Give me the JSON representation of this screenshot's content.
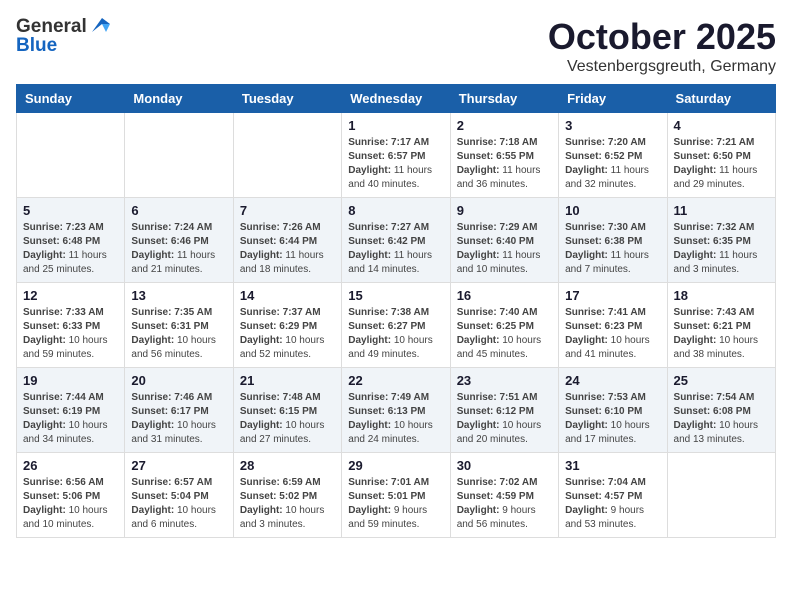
{
  "header": {
    "logo_general": "General",
    "logo_blue": "Blue",
    "month": "October 2025",
    "location": "Vestenbergsgreuth, Germany"
  },
  "weekdays": [
    "Sunday",
    "Monday",
    "Tuesday",
    "Wednesday",
    "Thursday",
    "Friday",
    "Saturday"
  ],
  "weeks": [
    [
      {
        "day": "",
        "info": ""
      },
      {
        "day": "",
        "info": ""
      },
      {
        "day": "",
        "info": ""
      },
      {
        "day": "1",
        "info": "Sunrise: 7:17 AM\nSunset: 6:57 PM\nDaylight: 11 hours\nand 40 minutes."
      },
      {
        "day": "2",
        "info": "Sunrise: 7:18 AM\nSunset: 6:55 PM\nDaylight: 11 hours\nand 36 minutes."
      },
      {
        "day": "3",
        "info": "Sunrise: 7:20 AM\nSunset: 6:52 PM\nDaylight: 11 hours\nand 32 minutes."
      },
      {
        "day": "4",
        "info": "Sunrise: 7:21 AM\nSunset: 6:50 PM\nDaylight: 11 hours\nand 29 minutes."
      }
    ],
    [
      {
        "day": "5",
        "info": "Sunrise: 7:23 AM\nSunset: 6:48 PM\nDaylight: 11 hours\nand 25 minutes."
      },
      {
        "day": "6",
        "info": "Sunrise: 7:24 AM\nSunset: 6:46 PM\nDaylight: 11 hours\nand 21 minutes."
      },
      {
        "day": "7",
        "info": "Sunrise: 7:26 AM\nSunset: 6:44 PM\nDaylight: 11 hours\nand 18 minutes."
      },
      {
        "day": "8",
        "info": "Sunrise: 7:27 AM\nSunset: 6:42 PM\nDaylight: 11 hours\nand 14 minutes."
      },
      {
        "day": "9",
        "info": "Sunrise: 7:29 AM\nSunset: 6:40 PM\nDaylight: 11 hours\nand 10 minutes."
      },
      {
        "day": "10",
        "info": "Sunrise: 7:30 AM\nSunset: 6:38 PM\nDaylight: 11 hours\nand 7 minutes."
      },
      {
        "day": "11",
        "info": "Sunrise: 7:32 AM\nSunset: 6:35 PM\nDaylight: 11 hours\nand 3 minutes."
      }
    ],
    [
      {
        "day": "12",
        "info": "Sunrise: 7:33 AM\nSunset: 6:33 PM\nDaylight: 10 hours\nand 59 minutes."
      },
      {
        "day": "13",
        "info": "Sunrise: 7:35 AM\nSunset: 6:31 PM\nDaylight: 10 hours\nand 56 minutes."
      },
      {
        "day": "14",
        "info": "Sunrise: 7:37 AM\nSunset: 6:29 PM\nDaylight: 10 hours\nand 52 minutes."
      },
      {
        "day": "15",
        "info": "Sunrise: 7:38 AM\nSunset: 6:27 PM\nDaylight: 10 hours\nand 49 minutes."
      },
      {
        "day": "16",
        "info": "Sunrise: 7:40 AM\nSunset: 6:25 PM\nDaylight: 10 hours\nand 45 minutes."
      },
      {
        "day": "17",
        "info": "Sunrise: 7:41 AM\nSunset: 6:23 PM\nDaylight: 10 hours\nand 41 minutes."
      },
      {
        "day": "18",
        "info": "Sunrise: 7:43 AM\nSunset: 6:21 PM\nDaylight: 10 hours\nand 38 minutes."
      }
    ],
    [
      {
        "day": "19",
        "info": "Sunrise: 7:44 AM\nSunset: 6:19 PM\nDaylight: 10 hours\nand 34 minutes."
      },
      {
        "day": "20",
        "info": "Sunrise: 7:46 AM\nSunset: 6:17 PM\nDaylight: 10 hours\nand 31 minutes."
      },
      {
        "day": "21",
        "info": "Sunrise: 7:48 AM\nSunset: 6:15 PM\nDaylight: 10 hours\nand 27 minutes."
      },
      {
        "day": "22",
        "info": "Sunrise: 7:49 AM\nSunset: 6:13 PM\nDaylight: 10 hours\nand 24 minutes."
      },
      {
        "day": "23",
        "info": "Sunrise: 7:51 AM\nSunset: 6:12 PM\nDaylight: 10 hours\nand 20 minutes."
      },
      {
        "day": "24",
        "info": "Sunrise: 7:53 AM\nSunset: 6:10 PM\nDaylight: 10 hours\nand 17 minutes."
      },
      {
        "day": "25",
        "info": "Sunrise: 7:54 AM\nSunset: 6:08 PM\nDaylight: 10 hours\nand 13 minutes."
      }
    ],
    [
      {
        "day": "26",
        "info": "Sunrise: 6:56 AM\nSunset: 5:06 PM\nDaylight: 10 hours\nand 10 minutes."
      },
      {
        "day": "27",
        "info": "Sunrise: 6:57 AM\nSunset: 5:04 PM\nDaylight: 10 hours\nand 6 minutes."
      },
      {
        "day": "28",
        "info": "Sunrise: 6:59 AM\nSunset: 5:02 PM\nDaylight: 10 hours\nand 3 minutes."
      },
      {
        "day": "29",
        "info": "Sunrise: 7:01 AM\nSunset: 5:01 PM\nDaylight: 9 hours\nand 59 minutes."
      },
      {
        "day": "30",
        "info": "Sunrise: 7:02 AM\nSunset: 4:59 PM\nDaylight: 9 hours\nand 56 minutes."
      },
      {
        "day": "31",
        "info": "Sunrise: 7:04 AM\nSunset: 4:57 PM\nDaylight: 9 hours\nand 53 minutes."
      },
      {
        "day": "",
        "info": ""
      }
    ]
  ]
}
